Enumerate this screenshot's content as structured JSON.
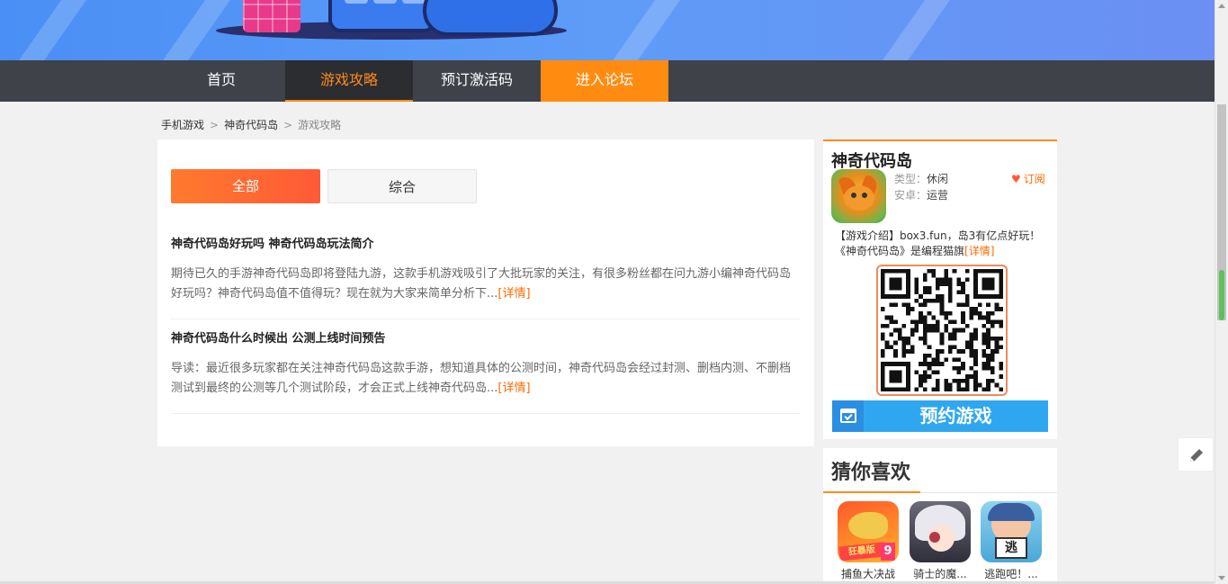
{
  "nav": {
    "items": [
      {
        "label": "首页"
      },
      {
        "label": "游戏攻略"
      },
      {
        "label": "预订激活码"
      },
      {
        "label": "进入论坛"
      }
    ]
  },
  "breadcrumb": {
    "items": [
      "手机游戏",
      "神奇代码岛",
      "游戏攻略"
    ],
    "separator": ">"
  },
  "tabs": [
    {
      "label": "全部"
    },
    {
      "label": "综合"
    }
  ],
  "articles": [
    {
      "title": "神奇代码岛好玩吗 神奇代码岛玩法简介",
      "desc": "期待已久的手游神奇代码岛即将登陆九游，这款手机游戏吸引了大批玩家的关注，有很多粉丝都在问九游小编神奇代码岛好玩吗？神奇代码岛值不值得玩？现在就为大家来简单分析下...",
      "more": "[详情]"
    },
    {
      "title": "神奇代码岛什么时候出 公测上线时间预告",
      "desc": "导读：最近很多玩家都在关注神奇代码岛这款手游，想知道具体的公测时间，神奇代码岛会经过封测、删档内测、不删档测试到最终的公测等几个测试阶段，才会正式上线神奇代码岛...",
      "more": "[详情]"
    }
  ],
  "game": {
    "name": "神奇代码岛",
    "type_label": "类型：",
    "type_value": "休闲",
    "android_label": "安卓：",
    "android_value": "运营",
    "subscribe": "订阅",
    "intro": "【游戏介绍】box3.fun，岛3有亿点好玩！《神奇代码岛》是编程猫旗",
    "intro_more": "[详情]",
    "reserve": "预约游戏"
  },
  "guess": {
    "title": "猜你喜欢",
    "items": [
      {
        "name": "捕鱼大决战",
        "badge": "狂暴版",
        "num": "9"
      },
      {
        "name": "骑士的魔..."
      },
      {
        "name": "逃跑吧！...",
        "sign": "逃"
      }
    ]
  },
  "colors": {
    "accent": "#ff8a1d",
    "nav_bg": "#3f4249",
    "reserve_blue": "#2fa7f0"
  }
}
